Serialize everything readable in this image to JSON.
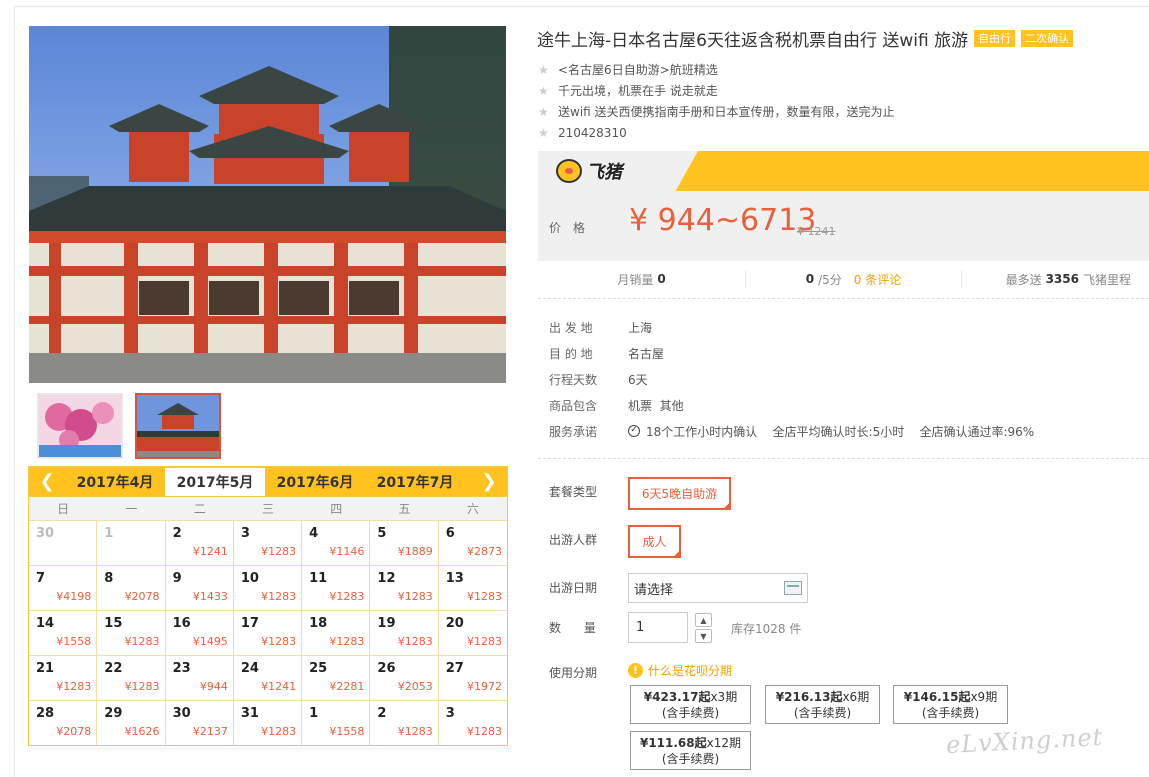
{
  "product": {
    "title": "途牛上海-日本名古屋6天往返含税机票自由行 送wifi 旅游",
    "badges": [
      "自由行",
      "二次确认"
    ],
    "features": [
      "<名古屋6日自助游>航班精选",
      "千元出境，机票在手 说走就走",
      "送wifi 送关西便携指南手册和日本宣传册，数量有限，送完为止",
      "210428310"
    ]
  },
  "brand": {
    "name": "飞猪"
  },
  "price": {
    "label": "价格",
    "value": "¥ 944~6713",
    "original": "¥ 1241"
  },
  "stats": {
    "monthly_label": "月销量",
    "monthly_value": "0",
    "rating_value": "0",
    "rating_suffix": "/5分",
    "reviews_link": "0 条评论",
    "miles_prefix": "最多送",
    "miles_value": "3356",
    "miles_suffix": "飞猪里程"
  },
  "info": [
    {
      "label": "出 发 地",
      "value": "上海"
    },
    {
      "label": "目 的 地",
      "value": "名古屋"
    },
    {
      "label": "行程天数",
      "value": "6天"
    },
    {
      "label": "商品包含",
      "value": "机票  其他"
    },
    {
      "label": "服务承诺",
      "value": "18个工作小时内确认    全店平均确认时长:5小时    全店确认通过率:96%"
    }
  ],
  "options": {
    "package_label": "套餐类型",
    "package_value": "6天5晚自助游",
    "people_label": "出游人群",
    "people_value": "成人",
    "date_label": "出游日期",
    "date_placeholder": "请选择",
    "qty_label": "数      量",
    "qty_value": "1",
    "stock": "库存1028 件",
    "installment_label": "使用分期",
    "installment_link": "什么是花呗分期"
  },
  "installments": [
    {
      "amount": "¥423.17起",
      "period": "x3期",
      "note": "(含手续费)"
    },
    {
      "amount": "¥216.13起",
      "period": "x6期",
      "note": "(含手续费)"
    },
    {
      "amount": "¥146.15起",
      "period": "x9期",
      "note": "(含手续费)"
    },
    {
      "amount": "¥111.68起",
      "period": "x12期",
      "note": "(含手续费)"
    }
  ],
  "calendar": {
    "months": [
      "2017年4月",
      "2017年5月",
      "2017年6月",
      "2017年7月"
    ],
    "active_month": 1,
    "weekdays": [
      "日",
      "一",
      "二",
      "三",
      "四",
      "五",
      "六"
    ],
    "cells": [
      {
        "d": "30",
        "p": "",
        "dim": true
      },
      {
        "d": "1",
        "p": "",
        "dim": true
      },
      {
        "d": "2",
        "p": "¥1241"
      },
      {
        "d": "3",
        "p": "¥1283"
      },
      {
        "d": "4",
        "p": "¥1146"
      },
      {
        "d": "5",
        "p": "¥1889"
      },
      {
        "d": "6",
        "p": "¥2873"
      },
      {
        "d": "7",
        "p": "¥4198"
      },
      {
        "d": "8",
        "p": "¥2078"
      },
      {
        "d": "9",
        "p": "¥1433"
      },
      {
        "d": "10",
        "p": "¥1283"
      },
      {
        "d": "11",
        "p": "¥1283"
      },
      {
        "d": "12",
        "p": "¥1283"
      },
      {
        "d": "13",
        "p": "¥1283"
      },
      {
        "d": "14",
        "p": "¥1558"
      },
      {
        "d": "15",
        "p": "¥1283"
      },
      {
        "d": "16",
        "p": "¥1495"
      },
      {
        "d": "17",
        "p": "¥1283"
      },
      {
        "d": "18",
        "p": "¥1283"
      },
      {
        "d": "19",
        "p": "¥1283"
      },
      {
        "d": "20",
        "p": "¥1283"
      },
      {
        "d": "21",
        "p": "¥1283"
      },
      {
        "d": "22",
        "p": "¥1283"
      },
      {
        "d": "23",
        "p": "¥944"
      },
      {
        "d": "24",
        "p": "¥1241"
      },
      {
        "d": "25",
        "p": "¥2281"
      },
      {
        "d": "26",
        "p": "¥2053"
      },
      {
        "d": "27",
        "p": "¥1972"
      },
      {
        "d": "28",
        "p": "¥2078"
      },
      {
        "d": "29",
        "p": "¥1626"
      },
      {
        "d": "30",
        "p": "¥2137"
      },
      {
        "d": "31",
        "p": "¥1283"
      },
      {
        "d": "1",
        "p": "¥1558"
      },
      {
        "d": "2",
        "p": "¥1283"
      },
      {
        "d": "3",
        "p": "¥1283"
      }
    ]
  },
  "watermark": "eLvXing.net",
  "colors": {
    "accent": "#ffc21e",
    "price": "#e8603c",
    "link": "#f0a000"
  }
}
